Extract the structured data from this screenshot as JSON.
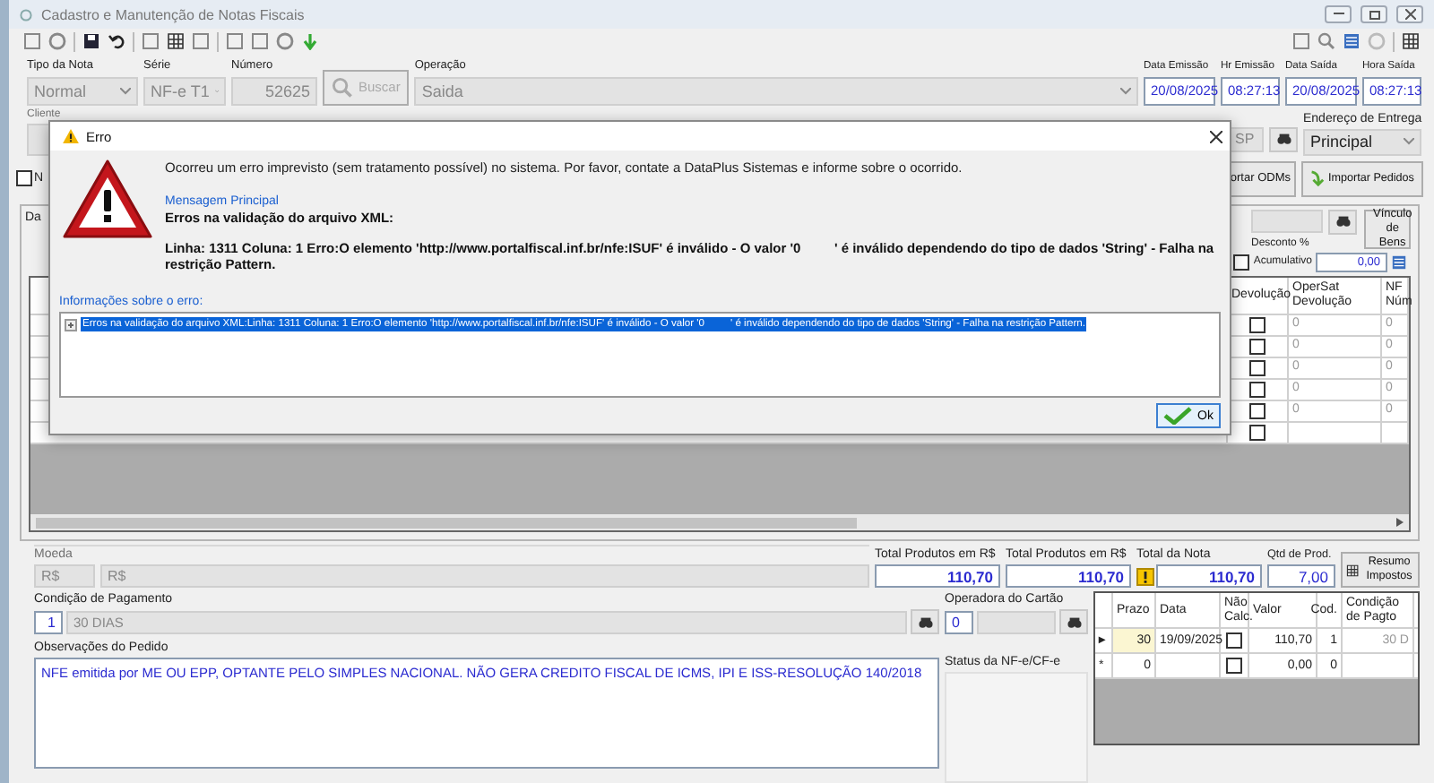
{
  "window": {
    "title": "Cadastro e Manutenção de Notas Fiscais"
  },
  "header": {
    "fields": [
      {
        "kind": "select",
        "label": "Tipo da Nota",
        "value": "Normal",
        "disabled": true
      },
      {
        "kind": "select",
        "label": "Série",
        "value": "NF-e T1",
        "disabled": true
      },
      {
        "kind": "input",
        "label": "Número",
        "value": "52625",
        "disabled": true
      },
      {
        "kind": "button",
        "label": "Buscar",
        "disabled": true
      },
      {
        "kind": "select",
        "label": "Operação",
        "value": "Saida",
        "disabled": true
      },
      {
        "kind": "input",
        "label": "Data Emissão",
        "value": "20/08/2025",
        "disabled": false
      },
      {
        "kind": "input",
        "label": "Hr Emissão",
        "value": "08:27:13",
        "disabled": false
      },
      {
        "kind": "input",
        "label": "Data Saída",
        "value": "20/08/2025",
        "disabled": false
      },
      {
        "kind": "input",
        "label": "Hora Saída",
        "value": "08:27:13",
        "disabled": false
      }
    ]
  },
  "customer": {
    "label": "Cliente",
    "state": "SP",
    "delivery_label": "Endereço de Entrega",
    "delivery": "Principal"
  },
  "options": {
    "checkbox": {
      "label": "N",
      "checked": false
    },
    "tab": "Da",
    "buttons": [
      "ortar ODMs",
      "Importar Pedidos"
    ]
  },
  "items": {
    "bond_button": "Vínculo de Bens",
    "discount_label": "Desconto %",
    "cumulative": {
      "label": "Acumulativo",
      "checked": false
    },
    "discount_value": "0,00",
    "columns": [
      "Devolução",
      "OperSat Devolução",
      "NF Núm"
    ],
    "rows": [
      {
        "returned": false,
        "operation": "0",
        "nf": "0"
      },
      {
        "returned": false,
        "operation": "0",
        "nf": "0"
      },
      {
        "returned": false,
        "operation": "0",
        "nf": "0"
      },
      {
        "returned": false,
        "operation": "0",
        "nf": "0"
      },
      {
        "returned": false,
        "operation": "0",
        "nf": "0"
      },
      {
        "returned": false
      }
    ]
  },
  "totals": {
    "currency_label": "Moeda",
    "currency_code": "R$",
    "currency_name": "R$",
    "fields": [
      {
        "label": "Total Produtos em R$",
        "value": "110,70",
        "warning": false
      },
      {
        "label": "Total Produtos em R$",
        "value": "110,70",
        "warning": false
      },
      {
        "label": "Total da Nota",
        "value": "110,70",
        "warning": true
      },
      {
        "label": "Qtd de Prod.",
        "value": "7,00",
        "warning": false
      }
    ],
    "summary_button": "Resumo Impostos"
  },
  "payment": {
    "label": "Condição de Pagamento",
    "code": "1",
    "name": "30 DIAS",
    "card_label": "Operadora do Cartão",
    "card_code": "0",
    "notes_label": "Observações do Pedido",
    "notes": "NFE emitida por ME OU EPP, OPTANTE PELO SIMPLES NACIONAL. NÃO GERA CREDITO FISCAL DE ICMS, IPI E ISS-RESOLUÇÃO 140/2018",
    "status_label": "Status da NF-e/CF-e"
  },
  "installments": {
    "columns": [
      "Prazo",
      "Data",
      "Não Calc.",
      "Valor",
      "Cod.",
      "Condição de Pagto"
    ],
    "rows": [
      {
        "indicator": "▸",
        "days": "30",
        "date": "19/09/2025",
        "no_calc": false,
        "value": "110,70",
        "code": "1",
        "condition": "30 D",
        "current": true
      },
      {
        "indicator": "*",
        "days": "0",
        "no_calc": false,
        "value": "0,00",
        "code": "0",
        "current": false
      }
    ]
  },
  "dialog": {
    "title": "Erro",
    "message": "Ocorreu um erro imprevisto (sem tratamento possível) no sistema. Por favor, contate a DataPlus Sistemas e informe sobre o ocorrido.",
    "main_label": "Mensagem Principal",
    "main_title": "Erros na validação do arquivo XML:",
    "main_detail": "Linha: 1311 Coluna: 1 Erro:O elemento 'http://www.portalfiscal.inf.br/nfe:ISUF' é inválido - O valor '0         ' é inválido dependendo do tipo de dados 'String' - Falha na restrição Pattern.",
    "info_label": "Informações sobre o erro:",
    "info_items": [
      {
        "text": "Erros na validação do arquivo XML:Linha: 1311 Coluna: 1 Erro:O elemento 'http://www.portalfiscal.inf.br/nfe:ISUF' é inválido - O valor '0         ' é inválido dependendo do tipo de dados 'String' - Falha na restrição Pattern.",
        "selected": true
      }
    ],
    "ok": "Ok"
  }
}
